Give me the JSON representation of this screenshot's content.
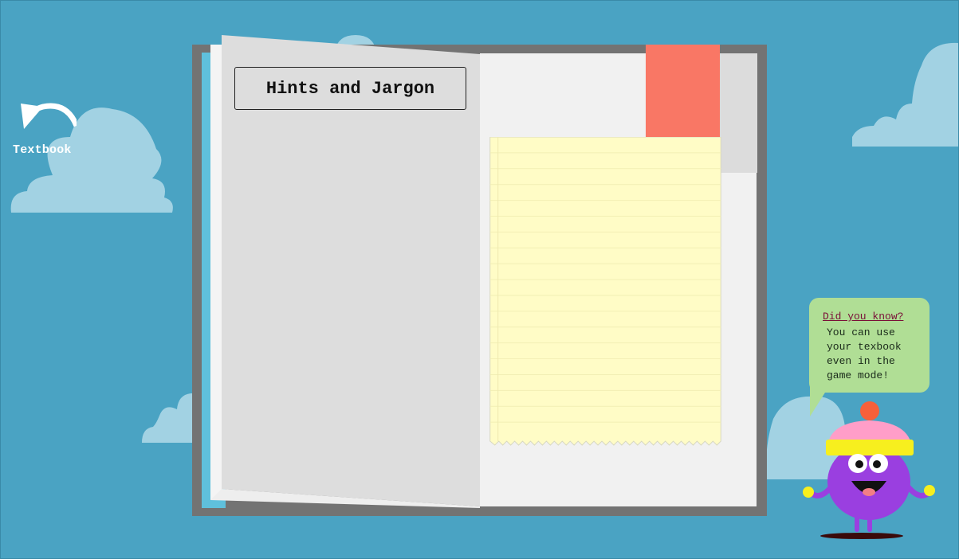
{
  "nav": {
    "back_label": "Textbook"
  },
  "page": {
    "title": "Hints and Jargon"
  },
  "tip": {
    "heading": "Did you know?",
    "lines": [
      "You can use",
      "your texbook",
      "even in the",
      "game mode!"
    ]
  },
  "colors": {
    "sky": "#4aa3c3",
    "cloud": "#a2d2e3",
    "book_cover": "#737373",
    "bookmark": "#f97765",
    "note_paper": "#fffcc6",
    "bubble": "#b0de95",
    "mascot_body": "#9a3fe0",
    "hat": "#ff9ec8",
    "hat_band": "#f7ef1e",
    "pom_pom": "#f7603a"
  },
  "icons": {
    "back": "curved-back-arrow-icon"
  }
}
